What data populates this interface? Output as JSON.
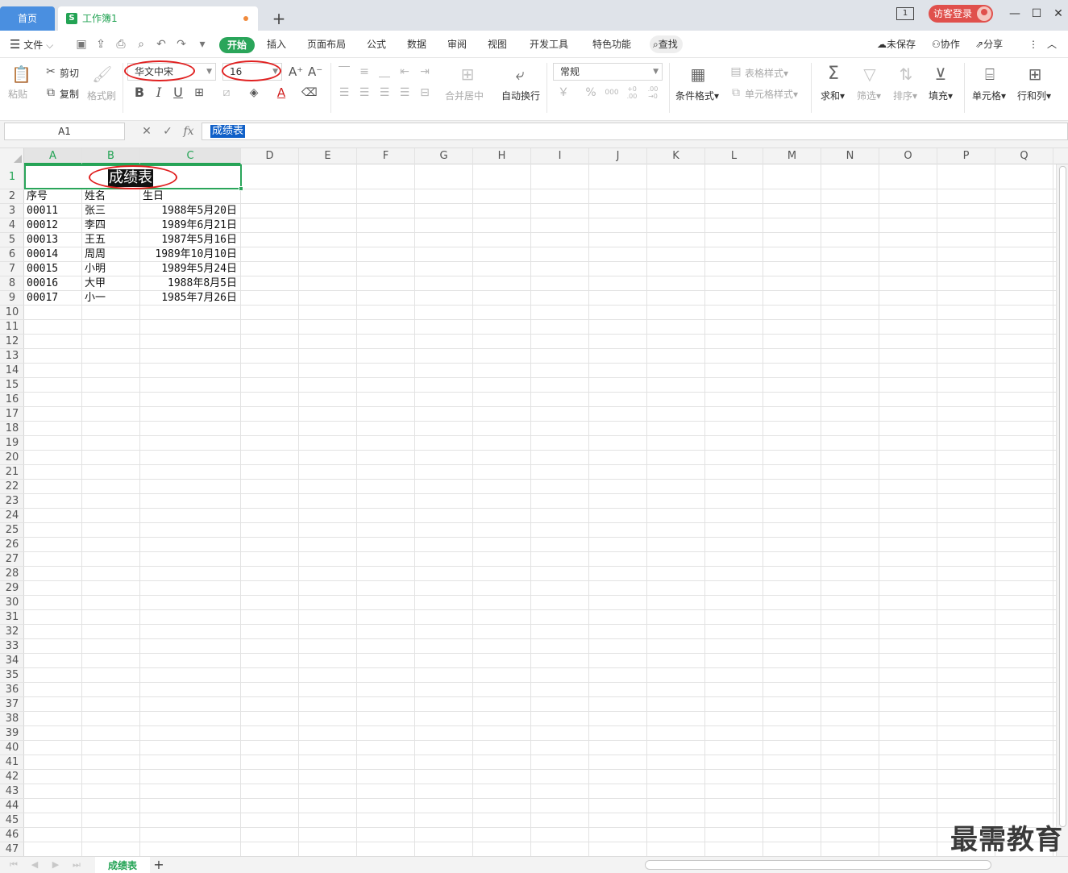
{
  "tabs": {
    "home": "首页",
    "document": "工作簿1",
    "doc_icon": "S",
    "add": "+"
  },
  "window": {
    "view_switch": "1",
    "login": "访客登录",
    "minimize": "—",
    "maximize": "☐",
    "close": "✕"
  },
  "menu": {
    "file": "文件",
    "items": [
      "开始",
      "插入",
      "页面布局",
      "公式",
      "数据",
      "审阅",
      "视图",
      "开发工具",
      "特色功能"
    ],
    "search": "查找",
    "unsaved": "未保存",
    "collab": "协作",
    "share": "分享"
  },
  "ribbon": {
    "paste": "粘贴",
    "cut": "剪切",
    "copy": "复制",
    "format_painter": "格式刷",
    "font_name": "华文中宋",
    "font_size": "16",
    "merge_center": "合并居中",
    "wrap_text": "自动换行",
    "number_format": "常规",
    "conditional_format": "条件格式",
    "table_style": "表格样式",
    "cell_style": "单元格样式",
    "sum": "求和",
    "filter": "筛选",
    "sort": "排序",
    "fill": "填充",
    "cell": "单元格",
    "rows_cols": "行和列",
    "currency": "￥",
    "percent": "%",
    "thousands": "000",
    "inc_decimal": "+0 .00",
    "dec_decimal": ".00 →0"
  },
  "formula_bar": {
    "name_box": "A1",
    "fx": "fx",
    "content": "成绩表"
  },
  "grid": {
    "columns": [
      "A",
      "B",
      "C",
      "D",
      "E",
      "F",
      "G",
      "H",
      "I",
      "J",
      "K",
      "L",
      "M",
      "N",
      "O",
      "P",
      "Q"
    ],
    "title": "成绩表",
    "headers": [
      "序号",
      "姓名",
      "生日"
    ],
    "rows": [
      [
        "00011",
        "张三",
        "1988年5月20日"
      ],
      [
        "00012",
        "李四",
        "1989年6月21日"
      ],
      [
        "00013",
        "王五",
        "1987年5月16日"
      ],
      [
        "00014",
        "周周",
        "1989年10月10日"
      ],
      [
        "00015",
        "小明",
        "1989年5月24日"
      ],
      [
        "00016",
        "大甲",
        "1988年8月5日"
      ],
      [
        "00017",
        "小一",
        "1985年7月26日"
      ]
    ],
    "row_count": 47
  },
  "sheet": {
    "name": "成绩表",
    "add": "+"
  },
  "watermark": "最需教育",
  "colors": {
    "accent_green": "#2aa55a",
    "home_tab_blue": "#4a8fe0",
    "login_red": "#e0504c",
    "annotation_red": "#e02020"
  }
}
